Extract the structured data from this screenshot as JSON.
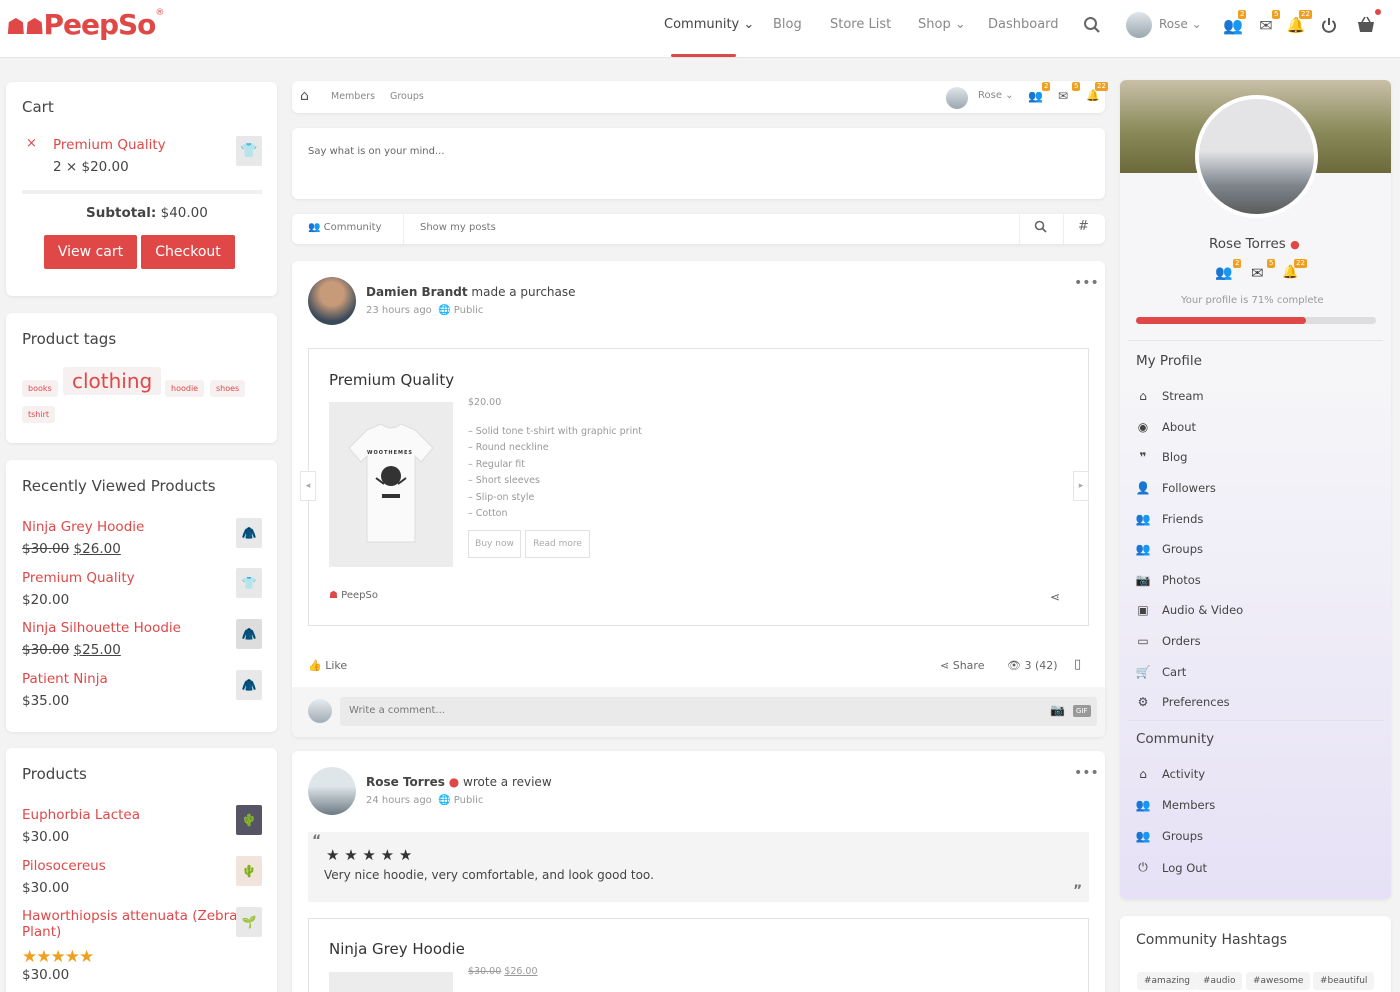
{
  "brand": {
    "logo_text": "PeepSo",
    "accent": "#e04848",
    "badge_color": "#f0a020"
  },
  "topnav": {
    "items": [
      "Community",
      "Blog",
      "Store List",
      "Shop",
      "Dashboard"
    ],
    "user_name": "Rose",
    "badges": {
      "friends": "2",
      "messages": "5",
      "notifications": "22"
    }
  },
  "cart": {
    "title": "Cart",
    "remove_glyph": "×",
    "item_name": "Premium Quality",
    "item_qty": "2 × $20.00",
    "subtotal_label": "Subtotal:",
    "subtotal_value": "$40.00",
    "view_cart": "View cart",
    "checkout": "Checkout"
  },
  "product_tags": {
    "title": "Product tags",
    "tags": [
      "books",
      "clothing",
      "hoodie",
      "shoes",
      "tshirt"
    ]
  },
  "recent": {
    "title": "Recently Viewed Products",
    "items": [
      {
        "name": "Ninja Grey Hoodie",
        "old": "$30.00",
        "price": "$26.00"
      },
      {
        "name": "Premium Quality",
        "price": "$20.00"
      },
      {
        "name": "Ninja Silhouette Hoodie",
        "old": "$30.00",
        "price": "$25.00"
      },
      {
        "name": "Patient Ninja",
        "price": "$35.00"
      }
    ]
  },
  "products": {
    "title": "Products",
    "items": [
      {
        "name": "Euphorbia Lactea",
        "price": "$30.00"
      },
      {
        "name": "Pilosocereus",
        "price": "$30.00"
      },
      {
        "name": "Haworthiopsis attenuata (Zebra Plant)",
        "name_line1": "Haworthiopsis attenuata (Zebra",
        "name_line2": "Plant)",
        "rating": 5,
        "stars": "★★★★★",
        "price": "$30.00"
      }
    ]
  },
  "subnav": {
    "members": "Members",
    "groups": "Groups",
    "user_name": "Rose",
    "badges": {
      "friends": "2",
      "messages": "5",
      "notifications": "22"
    }
  },
  "composer": {
    "placeholder": "Say what is on your mind..."
  },
  "filters": {
    "community": "Community",
    "show_my_posts": "Show my posts"
  },
  "post1": {
    "author": "Damien Brandt",
    "action": "made a purchase",
    "time": "23 hours ago",
    "privacy": "Public",
    "product": {
      "title": "Premium Quality",
      "price": "$20.00",
      "features": [
        "– Solid tone t-shirt with graphic print",
        "– Round neckline",
        "– Regular fit",
        "– Short sleeves",
        "– Slip-on style",
        "– Cotton"
      ],
      "buy_now": "Buy now",
      "read_more": "Read more",
      "shirt_text": "WOOTHEMES",
      "source": "PeepSo"
    },
    "like": "Like",
    "share": "Share",
    "views": "3 (42)",
    "comment_placeholder": "Write a comment...",
    "gif": "GIF"
  },
  "post2": {
    "author": "Rose Torres",
    "action": "wrote a review",
    "time": "24 hours ago",
    "privacy": "Public",
    "rating": 5,
    "stars": "★ ★ ★ ★ ★",
    "review": "Very nice hoodie, very comfortable, and look good too.",
    "product_title": "Ninja Grey Hoodie",
    "old_price": "$30.00",
    "price": "$26.00"
  },
  "profile": {
    "name": "Rose Torres",
    "badges": {
      "friends": "2",
      "messages": "5",
      "notifications": "22"
    },
    "completion_text": "Your profile is 71% complete",
    "completion": 0.71
  },
  "my_profile": {
    "title": "My Profile",
    "items": [
      "Stream",
      "About",
      "Blog",
      "Followers",
      "Friends",
      "Groups",
      "Photos",
      "Audio & Video",
      "Orders",
      "Cart",
      "Preferences"
    ]
  },
  "community_menu": {
    "title": "Community",
    "items": [
      "Activity",
      "Members",
      "Groups",
      "Log Out"
    ]
  },
  "hashtags": {
    "title": "Community Hashtags",
    "items": [
      "#amazing",
      "#audio",
      "#awesome",
      "#beautiful"
    ]
  }
}
